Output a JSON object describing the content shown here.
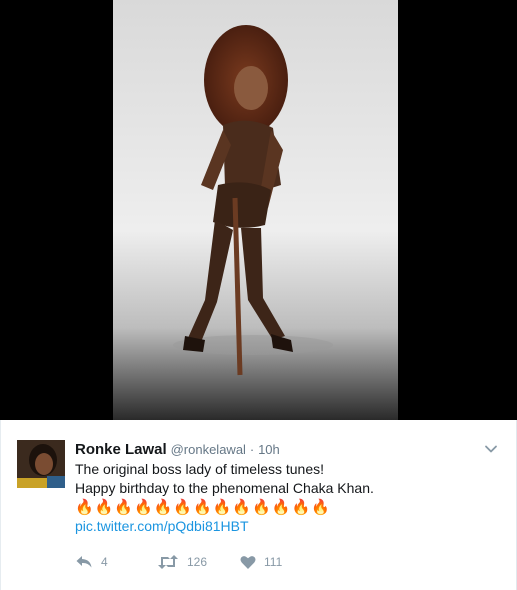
{
  "tweet": {
    "author_name": "Ronke Lawal",
    "author_handle": "@ronkelawal",
    "separator": "·",
    "time": "10h",
    "text_line_1": "The original boss lady of timeless tunes!",
    "text_line_2": "Happy birthday to the phenomenal Chaka Khan.",
    "emoji_line": "🔥🔥🔥🔥🔥🔥🔥🔥🔥🔥🔥🔥🔥",
    "link_text": "pic.twitter.com/pQdbi81HBT"
  },
  "actions": {
    "reply_count": "4",
    "retweet_count": "126",
    "like_count": "111"
  },
  "colors": {
    "link": "#1b95e0",
    "muted": "#8899a6",
    "viewer_background": "#000000"
  },
  "icons": {
    "reply": "reply-icon",
    "retweet": "retweet-icon",
    "like": "heart-icon",
    "more": "chevron-down-icon"
  }
}
